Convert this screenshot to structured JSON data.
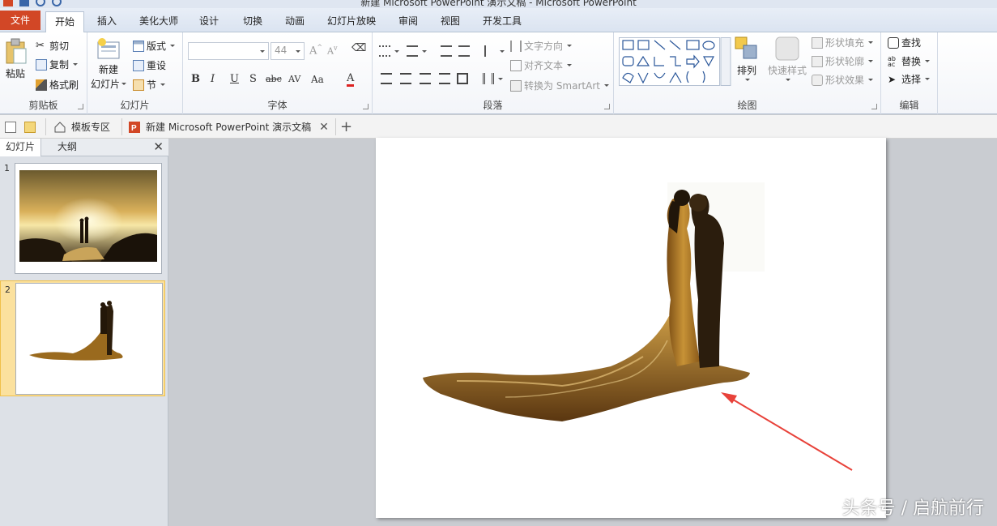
{
  "window": {
    "title": "新建 Microsoft PowerPoint 演示文稿 - Microsoft PowerPoint"
  },
  "tabs": {
    "file": "文件",
    "items": [
      "开始",
      "插入",
      "美化大师",
      "设计",
      "切换",
      "动画",
      "幻灯片放映",
      "审阅",
      "视图",
      "开发工具"
    ]
  },
  "clipboard": {
    "paste": "粘贴",
    "cut": "剪切",
    "copy": "复制",
    "format_painter": "格式刷",
    "label": "剪贴板"
  },
  "slides_group": {
    "new_slide_line1": "新建",
    "new_slide_line2": "幻灯片",
    "layout": "版式",
    "reset": "重设",
    "section": "节",
    "label": "幻灯片"
  },
  "font": {
    "size": "44",
    "label": "字体"
  },
  "paragraph": {
    "text_direction": "文字方向",
    "align_text": "对齐文本",
    "smartart": "转换为 SmartArt",
    "label": "段落"
  },
  "drawing": {
    "arrange": "排列",
    "quick_styles": "快速样式",
    "shape_fill": "形状填充",
    "shape_outline": "形状轮廓",
    "shape_effects": "形状效果",
    "label": "绘图"
  },
  "editing": {
    "find": "查找",
    "replace": "替换",
    "select": "选择",
    "label": "编辑"
  },
  "doc_tabs": {
    "templates": "模板专区",
    "document": "新建 Microsoft PowerPoint 演示文稿"
  },
  "panel": {
    "slides_tab": "幻灯片",
    "outline_tab": "大纲",
    "slide1_num": "1",
    "slide2_num": "2"
  },
  "watermark": "头条号 / 启航前行",
  "colors": {
    "file_tab": "#d24726",
    "accent": "#2b579a",
    "arrow": "#e8423a"
  }
}
